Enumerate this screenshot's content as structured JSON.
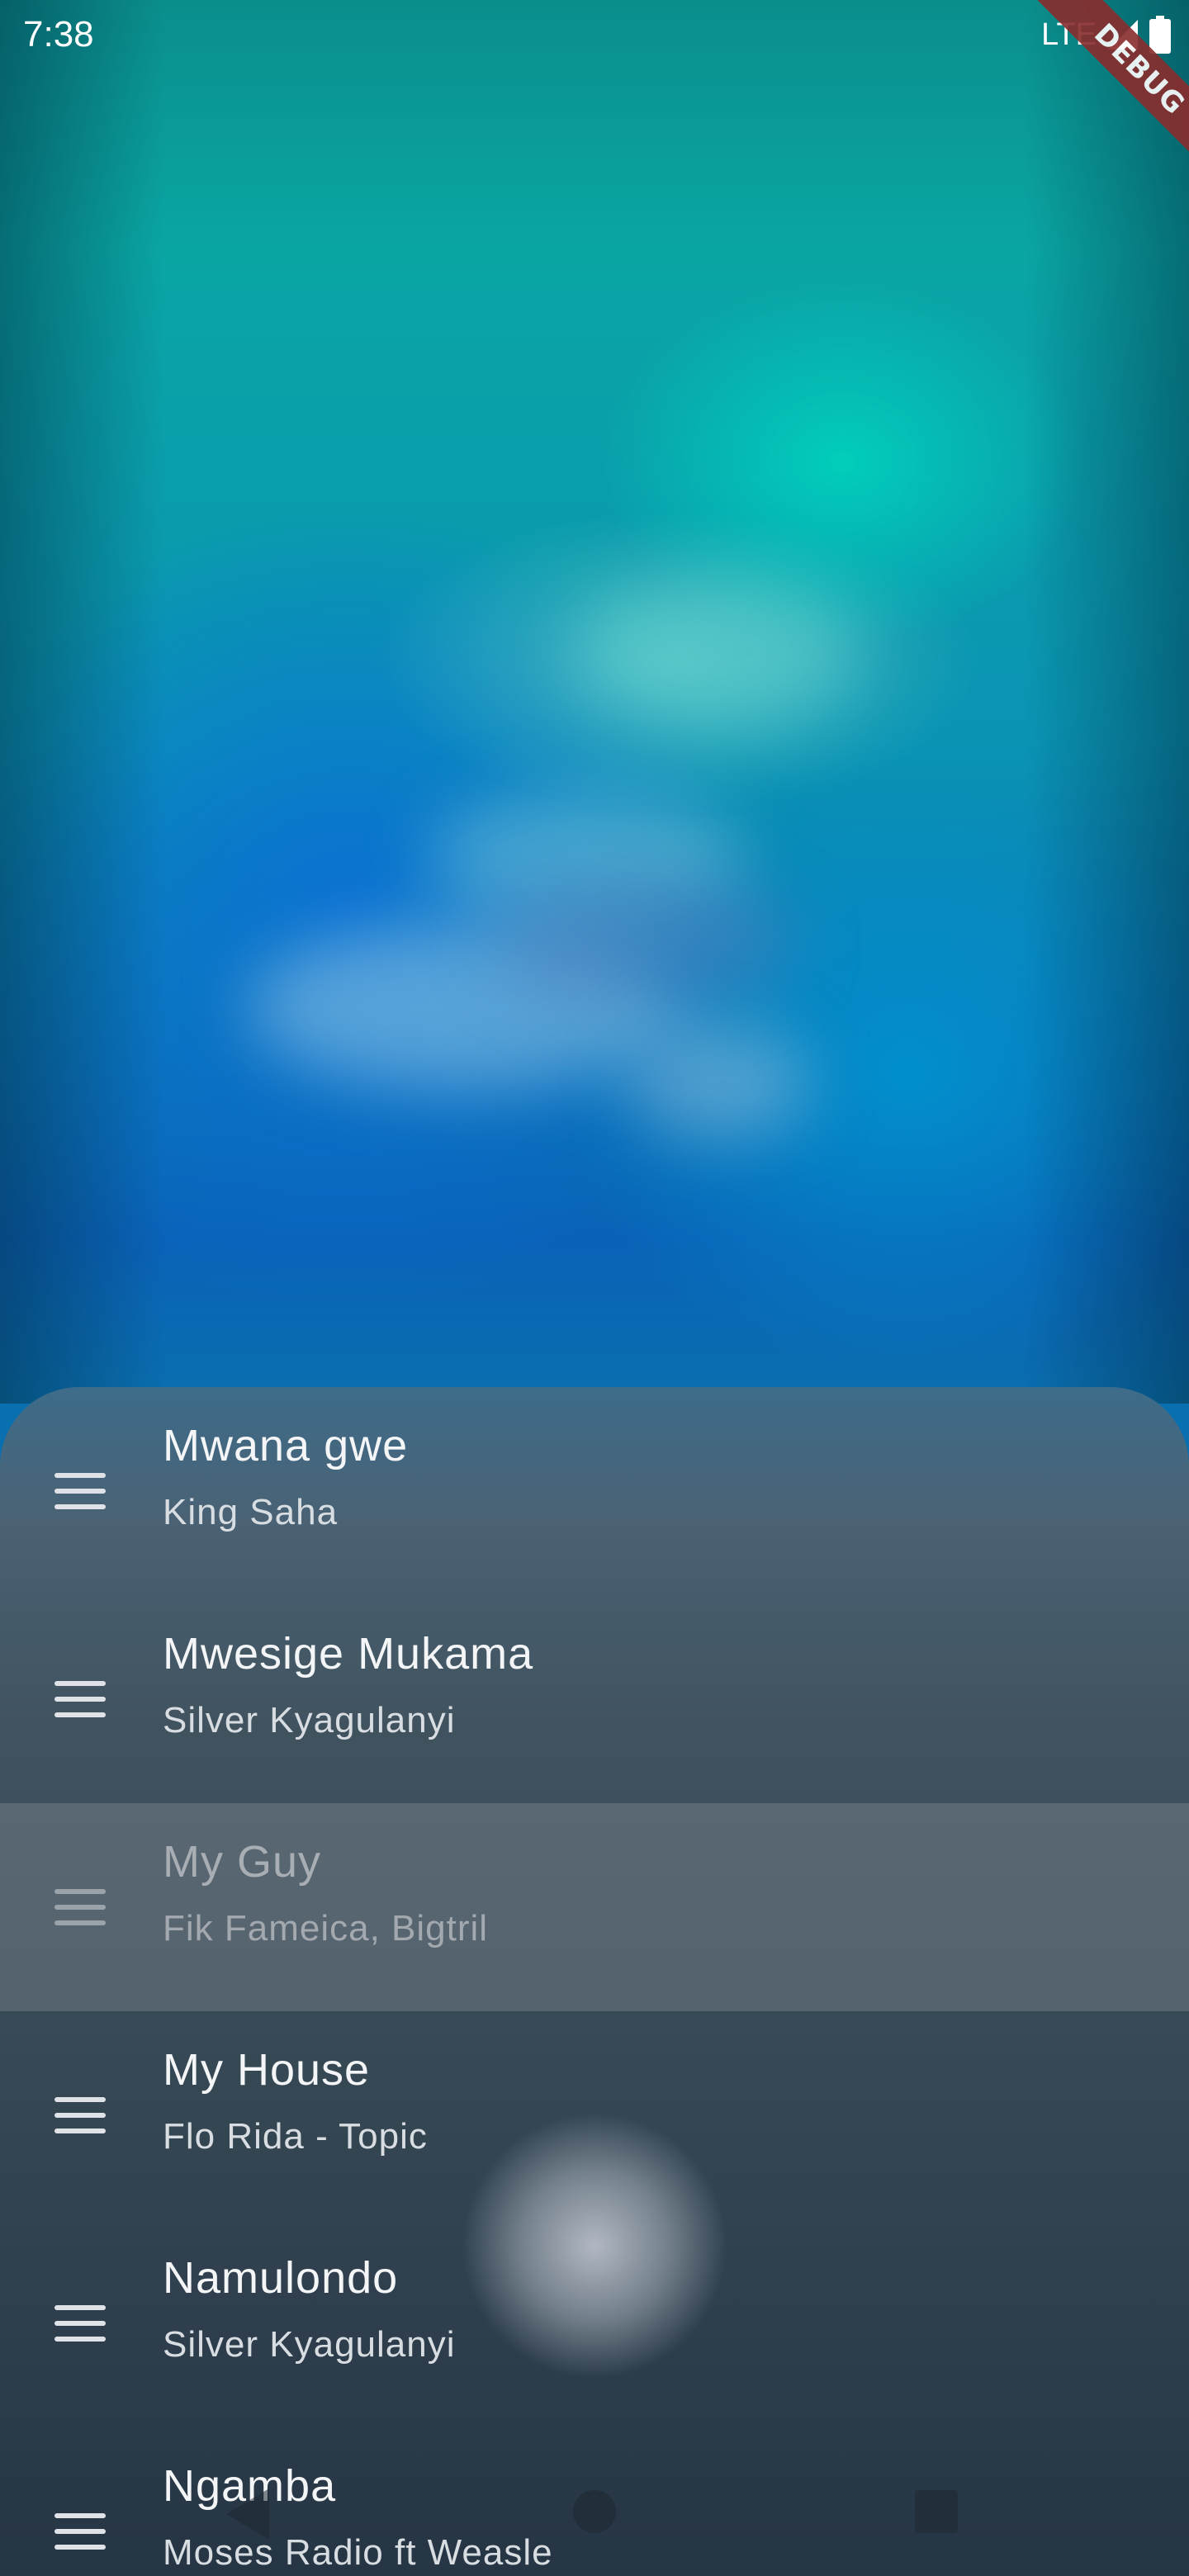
{
  "status_bar": {
    "time": "7:38",
    "network": "LTE",
    "signal_icon": "signal-icon",
    "battery_icon": "battery-icon"
  },
  "debug_banner": {
    "label": "DEBUG",
    "color": "#8a2c2c"
  },
  "playlist": {
    "items": [
      {
        "title": "Mwana gwe",
        "artist": "King Saha",
        "dragging": false
      },
      {
        "title": "Mwesige Mukama",
        "artist": "Silver Kyagulanyi",
        "dragging": false
      },
      {
        "title": "My Guy",
        "artist": "Fik Fameica, Bigtril",
        "dragging": true
      },
      {
        "title": "My House",
        "artist": "Flo Rida - Topic",
        "dragging": false
      },
      {
        "title": "Namulondo",
        "artist": "Silver Kyagulanyi",
        "dragging": false
      },
      {
        "title": "Ngamba",
        "artist": "Moses Radio ft Weasle",
        "dragging": false
      }
    ],
    "handle_icon": "drag-handle-icon"
  },
  "nav_bar": {
    "back_icon": "back-triangle-icon",
    "home_icon": "home-circle-icon",
    "recents_icon": "recents-square-icon"
  },
  "colors": {
    "background_top": "#0a8e8c",
    "background_mid": "#0a62b8",
    "sheet_top": "#3d6c8a",
    "sheet_bottom": "#263544",
    "text_primary": "#f3f5f7",
    "text_secondary": "#d8dde2"
  }
}
